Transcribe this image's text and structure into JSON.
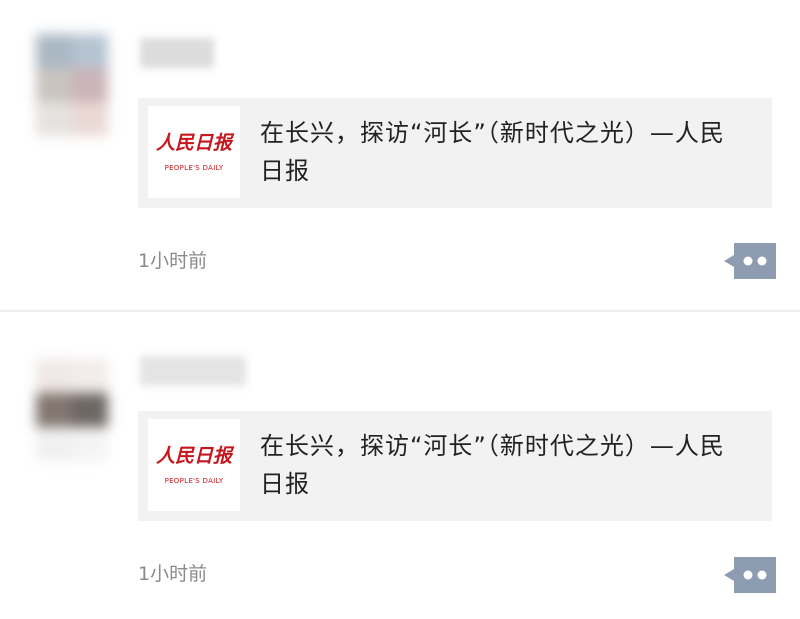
{
  "posts": [
    {
      "card": {
        "logo_cn": "人民日报",
        "logo_en": "PEOPLE'S DAILY",
        "headline": "在长兴，探访“河长”（新时代之光）—人民日报"
      },
      "time": "1小时前",
      "more_icon": "more-dots-icon"
    },
    {
      "card": {
        "logo_cn": "人民日报",
        "logo_en": "PEOPLE'S DAILY",
        "headline": "在长兴，探访“河长”（新时代之光）—人民日报"
      },
      "time": "1小时前",
      "more_icon": "more-dots-icon"
    }
  ],
  "colors": {
    "logo_red": "#c8161d",
    "card_bg": "#f2f2f2",
    "time_gray": "#8a8a8a",
    "more_button": "#8e9cb2"
  }
}
